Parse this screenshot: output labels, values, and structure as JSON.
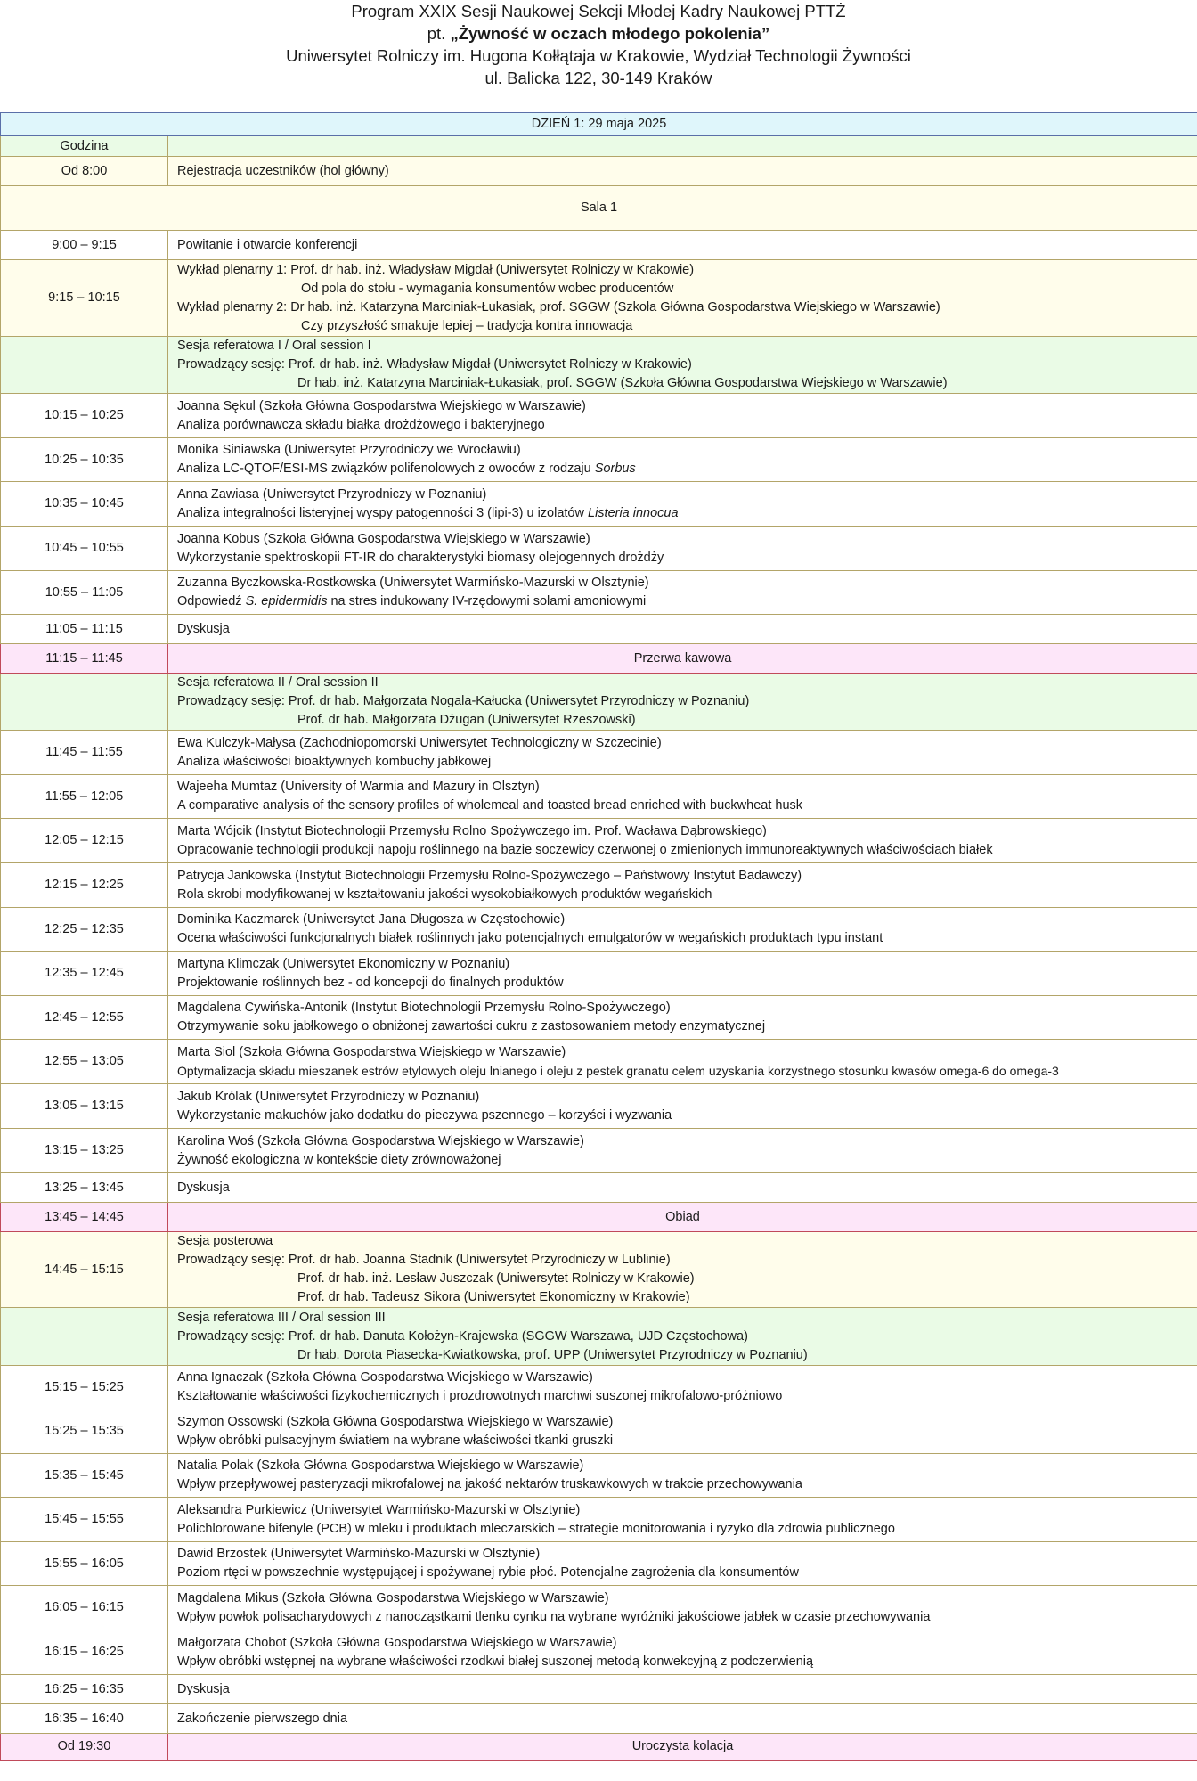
{
  "header": {
    "line1": "Program XXIX Sesji Naukowej Sekcji Młodej Kadry Naukowej PTTŻ",
    "line2_prefix": "pt. ",
    "line2_title": "„Żywność w oczach młodego pokolenia”",
    "line3": "Uniwersytet Rolniczy im. Hugona Kołłątaja w Krakowie, Wydział Technologii Żywności",
    "line4": "ul. Balicka 122,  30-149 Kraków"
  },
  "day_title": "DZIEŃ 1: 29 maja 2025",
  "col_header_time": "Godzina",
  "registration": {
    "time": "Od 8:00",
    "text": "Rejestracja uczestników (hol główny)"
  },
  "room": "Sala 1",
  "opening": {
    "time": "9:00 – 9:15",
    "text": "Powitanie i otwarcie konferencji"
  },
  "plenary": {
    "time": "9:15 – 10:15",
    "l1": "Wykład plenarny 1: Prof. dr hab. inż. Władysław Migdał (Uniwersytet Rolniczy w Krakowie)",
    "l2": "Od pola do stołu - wymagania konsumentów wobec producentów",
    "l3": "Wykład plenarny 2: Dr hab. inż. Katarzyna Marciniak-Łukasiak, prof. SGGW (Szkoła Główna Gospodarstwa Wiejskiego w Warszawie)",
    "l4": "Czy przyszłość smakuje lepiej – tradycja kontra innowacja"
  },
  "session1": {
    "title": "Sesja referatowa I / Oral session I",
    "chair1": "Prowadzący sesję: Prof. dr hab. inż. Władysław Migdał (Uniwersytet Rolniczy w Krakowie)",
    "chair2": "Dr hab. inż. Katarzyna Marciniak-Łukasiak, prof. SGGW (Szkoła Główna Gospodarstwa Wiejskiego w Warszawie)"
  },
  "talks1": [
    {
      "time": "10:15 – 10:25",
      "author": "Joanna Sękul (Szkoła Główna Gospodarstwa Wiejskiego w Warszawie)",
      "title": "Analiza porównawcza składu białka drożdżowego i bakteryjnego",
      "it": "",
      "title_after": ""
    },
    {
      "time": "10:25 – 10:35",
      "author": "Monika Siniawska (Uniwersytet Przyrodniczy we Wrocławiu)",
      "title": "Analiza LC-QTOF/ESI-MS związków polifenolowych z owoców z rodzaju ",
      "it": "Sorbus",
      "title_after": ""
    },
    {
      "time": "10:35 – 10:45",
      "author": "Anna Zawiasa (Uniwersytet Przyrodniczy w Poznaniu)",
      "title": "Analiza integralności listeryjnej wyspy patogenności 3 (lipi-3) u izolatów ",
      "it": "Listeria innocua",
      "title_after": ""
    },
    {
      "time": "10:45 – 10:55",
      "author": "Joanna Kobus (Szkoła Główna Gospodarstwa Wiejskiego w Warszawie)",
      "title": "Wykorzystanie spektroskopii FT-IR do charakterystyki biomasy olejogennych drożdży",
      "it": "",
      "title_after": ""
    },
    {
      "time": "10:55 – 11:05",
      "author": "Zuzanna Byczkowska-Rostkowska (Uniwersytet Warmińsko-Mazurski w Olsztynie)",
      "title": "Odpowiedź ",
      "it": "S. epidermidis",
      "title_after": " na stres indukowany IV-rzędowymi solami amoniowymi"
    }
  ],
  "discussion1": {
    "time": "11:05 – 11:15",
    "text": "Dyskusja"
  },
  "coffee": {
    "time": "11:15 – 11:45",
    "text": "Przerwa kawowa"
  },
  "session2": {
    "title": "Sesja referatowa II / Oral session II",
    "chair1": "Prowadzący sesję: Prof. dr hab. Małgorzata Nogala-Kałucka (Uniwersytet Przyrodniczy w Poznaniu)",
    "chair2": "Prof. dr hab. Małgorzata Dżugan (Uniwersytet Rzeszowski)"
  },
  "talks2": [
    {
      "time": "11:45 – 11:55",
      "author": "Ewa Kulczyk-Małysa (Zachodniopomorski Uniwersytet Technologiczny w Szczecinie)",
      "title": "Analiza właściwości bioaktywnych kombuchy jabłkowej"
    },
    {
      "time": "11:55 – 12:05",
      "author": "Wajeeha Mumtaz (University of Warmia and Mazury in Olsztyn)",
      "title": "A comparative analysis of the sensory profiles of wholemeal and toasted bread enriched with buckwheat husk"
    },
    {
      "time": "12:05 – 12:15",
      "author": "Marta Wójcik (Instytut Biotechnologii Przemysłu Rolno Spożywczego im. Prof. Wacława Dąbrowskiego)",
      "title": "Opracowanie technologii produkcji napoju roślinnego na bazie soczewicy czerwonej o zmienionych immunoreaktywnych właściwościach białek"
    },
    {
      "time": "12:15 – 12:25",
      "author": "Patrycja Jankowska (Instytut Biotechnologii Przemysłu Rolno-Spożywczego – Państwowy Instytut Badawczy)",
      "title": "Rola skrobi modyfikowanej w kształtowaniu jakości wysokobiałkowych produktów wegańskich"
    },
    {
      "time": "12:25 – 12:35",
      "author": "Dominika Kaczmarek (Uniwersytet Jana Długosza w Częstochowie)",
      "title": "Ocena właściwości funkcjonalnych białek roślinnych jako potencjalnych emulgatorów w wegańskich produktach typu instant"
    },
    {
      "time": "12:35 – 12:45",
      "author": "Martyna Klimczak (Uniwersytet Ekonomiczny w Poznaniu)",
      "title": "Projektowanie roślinnych bez - od koncepcji do finalnych produktów"
    },
    {
      "time": "12:45 – 12:55",
      "author": "Magdalena Cywińska-Antonik (Instytut Biotechnologii Przemysłu Rolno-Spożywczego)",
      "title": "Otrzymywanie soku jabłkowego o obniżonej zawartości cukru z zastosowaniem metody enzymatycznej"
    },
    {
      "time": "12:55 – 13:05",
      "author": "Marta Siol (Szkoła Główna Gospodarstwa Wiejskiego w Warszawie)",
      "title": "Optymalizacja składu mieszanek estrów etylowych oleju lnianego i oleju z pestek granatu celem uzyskania korzystnego stosunku kwasów omega-6 do omega-3"
    },
    {
      "time": "13:05 – 13:15",
      "author": "Jakub Królak (Uniwersytet Przyrodniczy w Poznaniu)",
      "title": "Wykorzystanie makuchów jako dodatku do pieczywa pszennego  – korzyści i wyzwania"
    },
    {
      "time": "13:15 – 13:25",
      "author": "Karolina Woś (Szkoła Główna Gospodarstwa Wiejskiego w Warszawie)",
      "title": "Żywność ekologiczna w kontekście diety zrównoważonej"
    }
  ],
  "discussion2": {
    "time": "13:25 – 13:45",
    "text": "Dyskusja"
  },
  "lunch": {
    "time": "13:45 – 14:45",
    "text": "Obiad"
  },
  "poster": {
    "time": "14:45 – 15:15",
    "title": "Sesja posterowa",
    "chair1": "Prowadzący sesję: Prof. dr hab. Joanna Stadnik (Uniwersytet Przyrodniczy w Lublinie)",
    "chair2": "Prof. dr hab. inż.  Lesław Juszczak (Uniwersytet Rolniczy w Krakowie)",
    "chair3": "Prof. dr hab. Tadeusz Sikora (Uniwersytet Ekonomiczny w Krakowie)"
  },
  "session3": {
    "title": "Sesja referatowa III / Oral session III",
    "chair1": "Prowadzący sesję: Prof. dr hab. Danuta Kołożyn-Krajewska (SGGW Warszawa, UJD Częstochowa)",
    "chair2": "Dr hab. Dorota Piasecka-Kwiatkowska, prof. UPP (Uniwersytet Przyrodniczy w Poznaniu)"
  },
  "talks3": [
    {
      "time": "15:15 – 15:25",
      "author": "Anna Ignaczak (Szkoła Główna Gospodarstwa Wiejskiego w Warszawie)",
      "title": "Kształtowanie właściwości fizykochemicznych i prozdrowotnych marchwi suszonej mikrofalowo-próżniowo"
    },
    {
      "time": "15:25 – 15:35",
      "author": "Szymon Ossowski (Szkoła Główna Gospodarstwa Wiejskiego w Warszawie)",
      "title": "Wpływ obróbki pulsacyjnym światłem na wybrane właściwości tkanki gruszki"
    },
    {
      "time": "15:35 – 15:45",
      "author": "Natalia Polak (Szkoła Główna Gospodarstwa Wiejskiego w Warszawie)",
      "title": "Wpływ przepływowej pasteryzacji mikrofalowej na jakość nektarów truskawkowych w trakcie przechowywania"
    },
    {
      "time": "15:45 – 15:55",
      "author": "Aleksandra Purkiewicz (Uniwersytet Warmińsko-Mazurski w Olsztynie)",
      "title": "Polichlorowane bifenyle (PCB) w mleku i produktach mleczarskich – strategie monitorowania i ryzyko dla zdrowia publicznego"
    },
    {
      "time": "15:55 – 16:05",
      "author": "Dawid Brzostek (Uniwersytet Warmińsko-Mazurski w Olsztynie)",
      "title": "Poziom rtęci w powszechnie występującej i spożywanej rybie płoć. Potencjalne zagrożenia dla konsumentów"
    },
    {
      "time": "16:05 – 16:15",
      "author": "Magdalena Mikus  (Szkoła Główna Gospodarstwa Wiejskiego w Warszawie)",
      "title": "Wpływ powłok polisacharydowych z nanocząstkami tlenku cynku na wybrane wyróżniki jakościowe jabłek w czasie przechowywania"
    },
    {
      "time": "16:15 – 16:25",
      "author": "Małgorzata Chobot (Szkoła Główna Gospodarstwa Wiejskiego w Warszawie)",
      "title": "Wpływ obróbki wstępnej na wybrane właściwości rzodkwi białej suszonej metodą konwekcyjną z podczerwienią"
    }
  ],
  "discussion3": {
    "time": "16:25 – 16:35",
    "text": "Dyskusja"
  },
  "closing": {
    "time": "16:35 – 16:40",
    "text": "Zakończenie pierwszego dnia"
  },
  "dinner": {
    "time": "Od 19:30",
    "text": "Uroczysta kolacja"
  }
}
